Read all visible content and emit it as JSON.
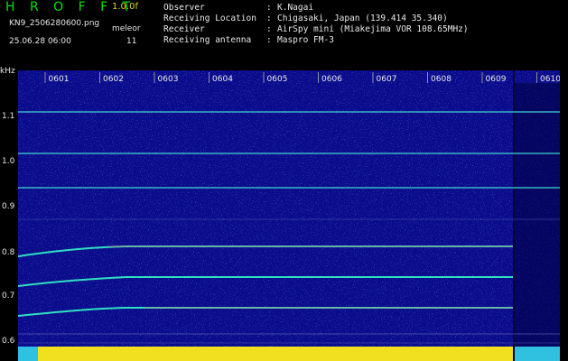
{
  "header": {
    "app_title": "H R O F F T",
    "version": "1.0.0f",
    "filename": "KN9_2506280600.png",
    "mode": "meleor",
    "mode_value": "11",
    "datetime": "25.06.28 06:00",
    "info": [
      {
        "label": "Observer",
        "value": "K.Nagai"
      },
      {
        "label": "Receiving Location",
        "value": "Chigasaki, Japan (139.414 35.340)"
      },
      {
        "label": "Receiver",
        "value": "AirSpy mini (Miakejima VOR 108.65MHz)"
      },
      {
        "label": "Receiving antenna",
        "value": "Maspro FM-3"
      }
    ],
    "separator": ":"
  },
  "spectrogram": {
    "y_unit": "kHz",
    "y_ticks": [
      "1.1",
      "1.0",
      "0.9",
      "0.8",
      "0.7",
      "0.6"
    ],
    "x_ticks": [
      "0601",
      "0602",
      "0603",
      "0604",
      "0605",
      "0606",
      "0607",
      "0608",
      "0609",
      "0610"
    ],
    "colors": {
      "background": "#0a0a8a",
      "trace": "#30e0c0",
      "power": "#f0e020"
    }
  }
}
